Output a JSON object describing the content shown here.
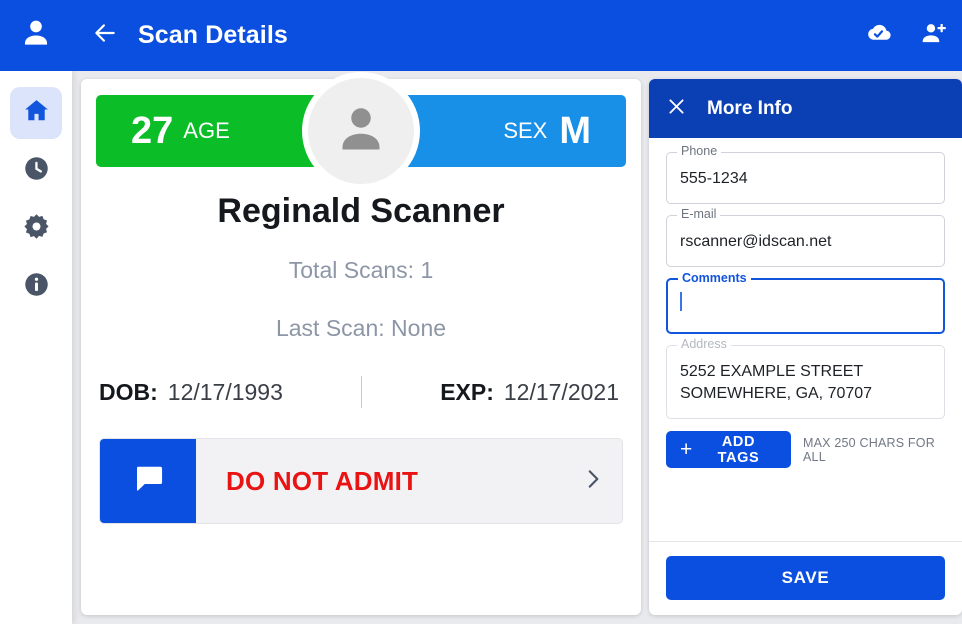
{
  "topbar": {
    "user_icon": "person-icon",
    "back_icon": "arrow-back-icon",
    "title": "Scan Details",
    "cloud_icon": "cloud-done-icon",
    "add_person_icon": "person-add-icon"
  },
  "sidebar": {
    "items": [
      {
        "icon": "home-icon",
        "name": "sidebar-item-home",
        "active": true
      },
      {
        "icon": "history-clock-icon",
        "name": "sidebar-item-history",
        "active": false
      },
      {
        "icon": "gear-icon",
        "name": "sidebar-item-settings",
        "active": false
      },
      {
        "icon": "info-icon",
        "name": "sidebar-item-info",
        "active": false
      }
    ]
  },
  "scan": {
    "age_value": "27",
    "age_label": "AGE",
    "sex_label": "SEX",
    "sex_value": "M",
    "avatar_icon": "person-avatar-icon",
    "name": "Reginald Scanner",
    "total_scans": "Total Scans: 1",
    "last_scan": "Last Scan: None",
    "dob_label": "DOB:",
    "dob_value": "12/17/1993",
    "exp_label": "EXP:",
    "exp_value": "12/17/2021",
    "banner_icon": "chat-bubble-icon",
    "banner_text": "DO NOT ADMIT",
    "banner_chevron": "chevron-right-icon"
  },
  "more_info": {
    "close_icon": "close-icon",
    "title": "More Info",
    "fields": [
      {
        "label": "Phone",
        "value": "555-1234",
        "state": "normal"
      },
      {
        "label": "E-mail",
        "value": "rscanner@idscan.net",
        "state": "normal"
      },
      {
        "label": "Comments",
        "value": "",
        "state": "focused"
      },
      {
        "label": "Address",
        "value": "5252 EXAMPLE STREET\nSOMEWHERE, GA, 70707",
        "state": "disabled"
      }
    ],
    "add_tags_plus": "+",
    "add_tags_label": "ADD TAGS",
    "max_chars_note": "MAX 250 CHARS FOR ALL",
    "save_label": "SAVE"
  },
  "colors": {
    "primary_blue": "#0b4fe0",
    "header_blue": "#0b3fb4",
    "age_green": "#0bbd27",
    "sex_blue": "#1890e8",
    "alert_red": "#e91313",
    "page_bg": "#e9eaee"
  }
}
